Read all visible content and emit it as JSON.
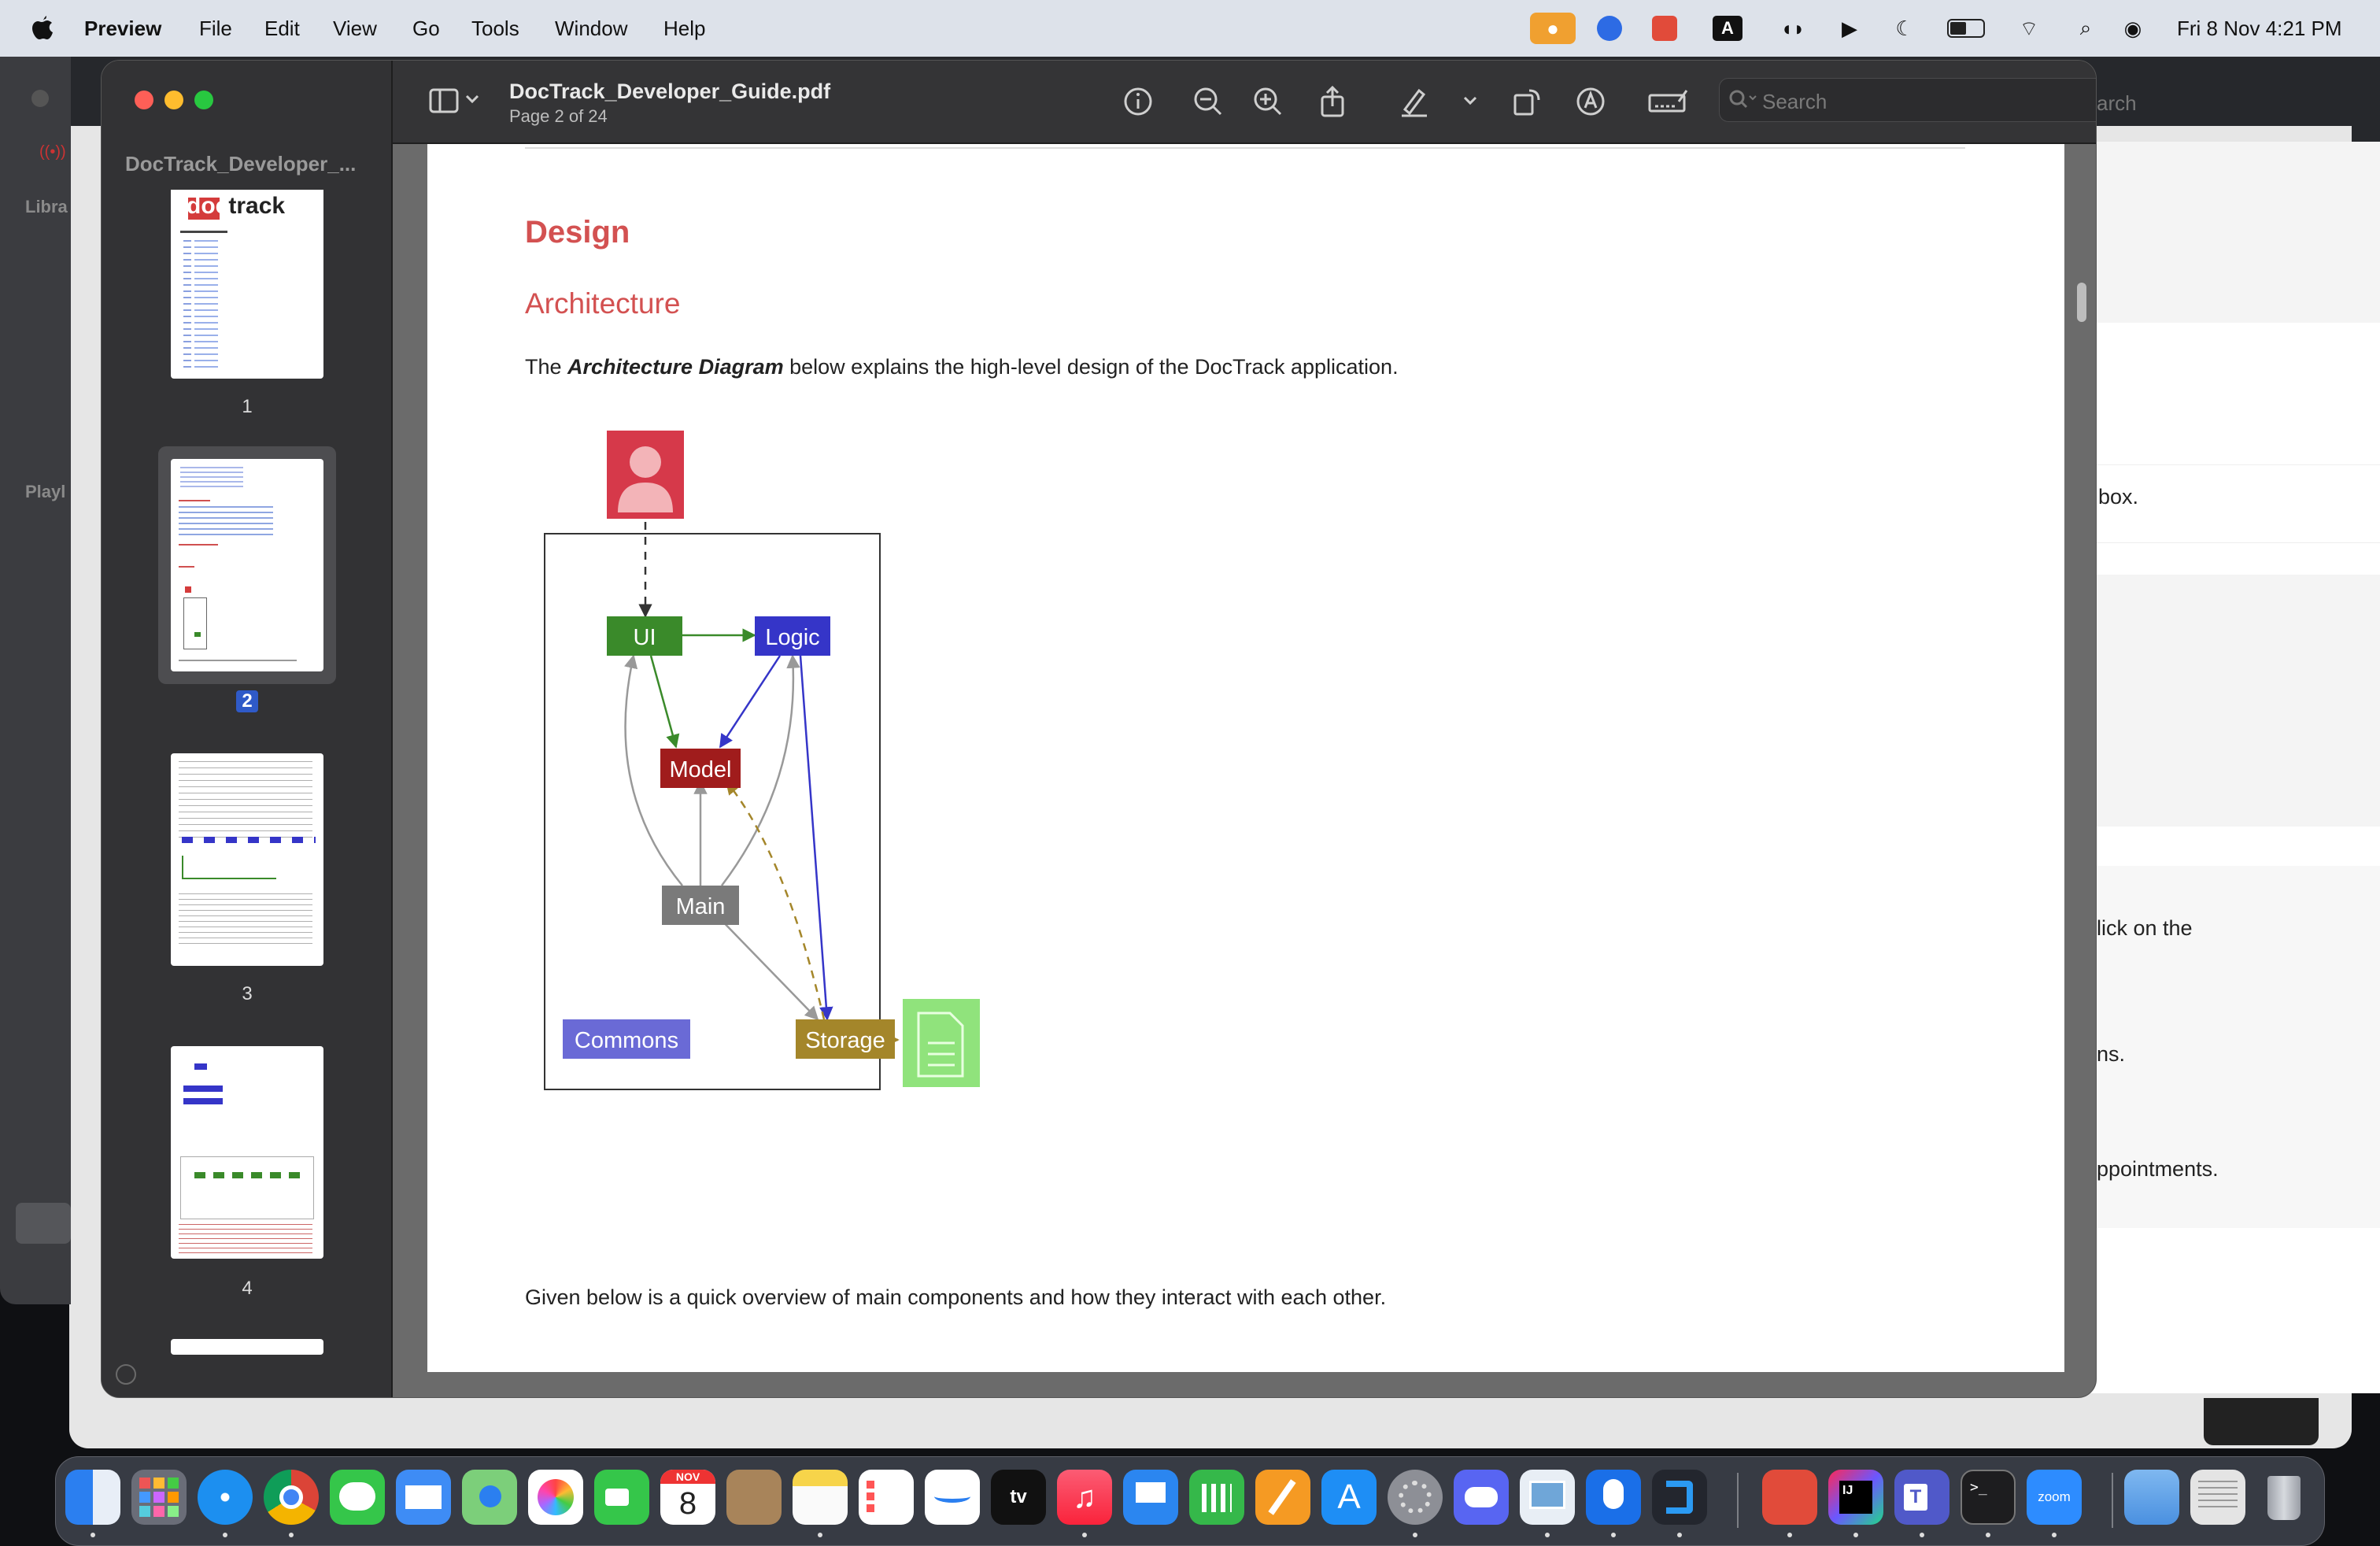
{
  "menubar": {
    "app": "Preview",
    "items": [
      "File",
      "Edit",
      "View",
      "Go",
      "Tools",
      "Window",
      "Help"
    ],
    "datetime": "Fri 8 Nov  4:21 PM"
  },
  "background_window": {
    "labels": [
      "Libra",
      "Playl"
    ],
    "search_fragment": "arch",
    "text_fragments": [
      "box.",
      "lick on the",
      "ns.",
      "ppointments."
    ]
  },
  "window": {
    "sidebar_title": "DocTrack_Developer_...",
    "thumbnails": [
      {
        "label": "1"
      },
      {
        "label": "2",
        "selected": true
      },
      {
        "label": "3"
      },
      {
        "label": "4"
      }
    ],
    "thumb1_logo_a": "doc",
    "thumb1_logo_b": "track",
    "toolbar": {
      "title": "DocTrack_Developer_Guide.pdf",
      "subtitle": "Page 2 of 24",
      "search_placeholder": "Search"
    }
  },
  "document": {
    "heading1": "Design",
    "heading2": "Architecture",
    "intro_before": "The ",
    "intro_emphasis": "Architecture Diagram",
    "intro_after": " below explains the high-level design of the DocTrack application.",
    "diagram": {
      "nodes": {
        "ui": "UI",
        "logic": "Logic",
        "model": "Model",
        "main": "Main",
        "commons": "Commons",
        "storage": "Storage"
      },
      "colors": {
        "ui": "#3a8a2a",
        "logic": "#3535c8",
        "model": "#a01c1c",
        "main": "#7a7a7a",
        "commons": "#6a6ad6",
        "storage": "#a4862a",
        "user": "#d6394a",
        "file": "#90e37c"
      }
    },
    "closing": "Given below is a quick overview of main components and how they interact with each other."
  },
  "dock": {
    "calendar_month": "NOV",
    "calendar_day": "8",
    "appletv_label": "tv",
    "zoom_label": "zoom"
  }
}
